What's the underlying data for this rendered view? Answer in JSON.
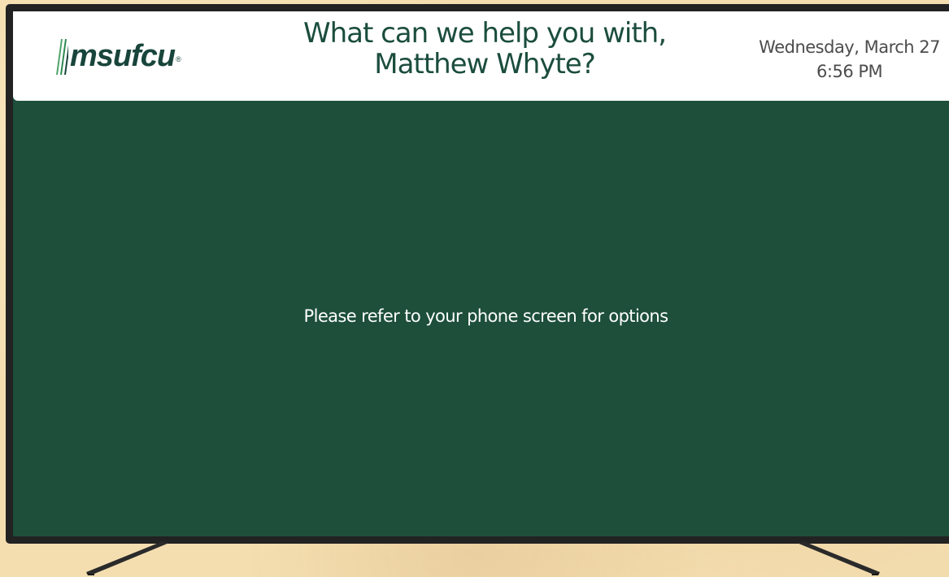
{
  "brand": {
    "logo_text": "msufcu",
    "logo_mark": "®",
    "color": "#18453b"
  },
  "header": {
    "greeting_line1": "What can we help you with,",
    "greeting_line2": "Matthew Whyte?",
    "date": "Wednesday, March 27",
    "time": "6:56 PM"
  },
  "main": {
    "message": "Please refer to your phone screen for options",
    "background_color": "#1d4f3b"
  },
  "device": {
    "frame_color": "#222222",
    "wall_color": "#f4deb0",
    "icons": [
      "logo-slashes-icon",
      "tv-stand-leg-icon"
    ]
  }
}
